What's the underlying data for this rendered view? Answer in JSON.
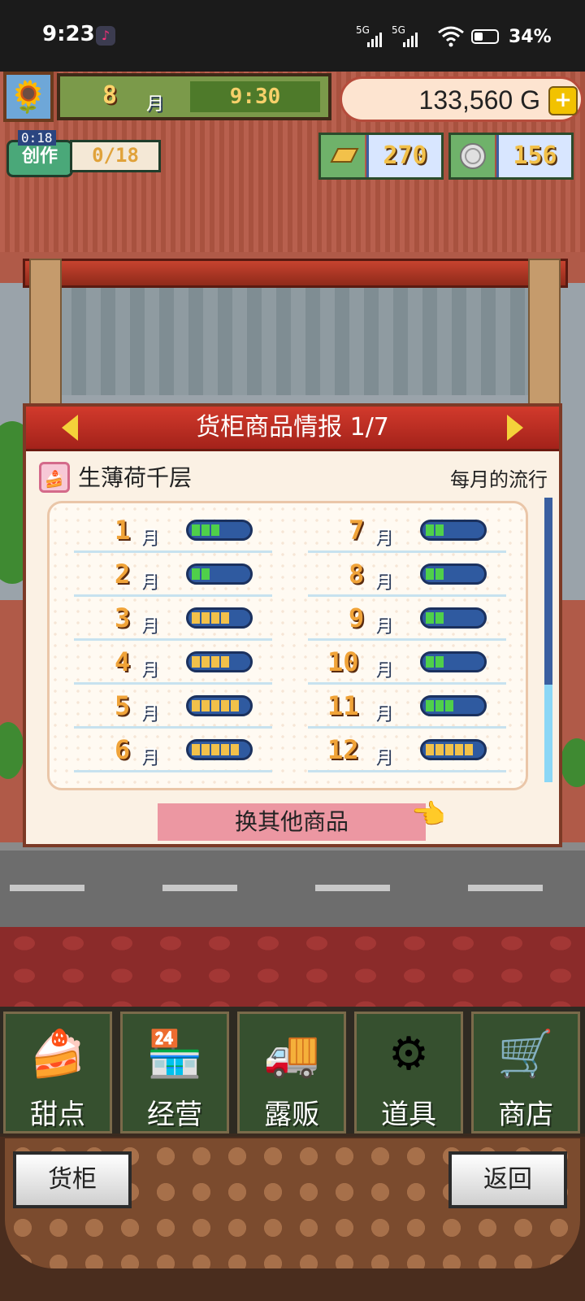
{
  "status_bar": {
    "time": "9:23",
    "network_1": "5G",
    "network_2": "5G",
    "battery": "34%"
  },
  "hud": {
    "month_num": "8",
    "month_label": "月",
    "clock": "9:30",
    "money": "133,560",
    "currency": "G",
    "add": "+",
    "create_badge": "创作",
    "create_timer": "0:18",
    "create_count": "0/18",
    "gold": "270",
    "silver": "156"
  },
  "dialog": {
    "title": "货柜商品情报 1/7",
    "item_name": "生薄荷千层",
    "trend_label": "每月的流行",
    "swap_button": "换其他商品",
    "month_suffix": "月",
    "months": [
      {
        "num": "1",
        "level": 3
      },
      {
        "num": "2",
        "level": 2
      },
      {
        "num": "3",
        "level": 4
      },
      {
        "num": "4",
        "level": 4
      },
      {
        "num": "5",
        "level": 5
      },
      {
        "num": "6",
        "level": 5
      },
      {
        "num": "7",
        "level": 2
      },
      {
        "num": "8",
        "level": 2
      },
      {
        "num": "9",
        "level": 2
      },
      {
        "num": "10",
        "level": 2
      },
      {
        "num": "11",
        "level": 3
      },
      {
        "num": "12",
        "level": 5
      }
    ]
  },
  "tabs": [
    {
      "label": "甜点",
      "icon": "cake-icon"
    },
    {
      "label": "经营",
      "icon": "shop-icon"
    },
    {
      "label": "露贩",
      "icon": "food-truck-icon"
    },
    {
      "label": "道具",
      "icon": "gear-bag-icon"
    },
    {
      "label": "商店",
      "icon": "cart-icon"
    }
  ],
  "bottom": {
    "left_button": "货柜",
    "right_button": "返回"
  },
  "colors": {
    "dialog_title": "#b92a20",
    "swap_button": "#ec97a2",
    "green_bar": "#4fd04a",
    "yellow_bar": "#f2c14a",
    "bar_bg": "#2f5aa0"
  }
}
